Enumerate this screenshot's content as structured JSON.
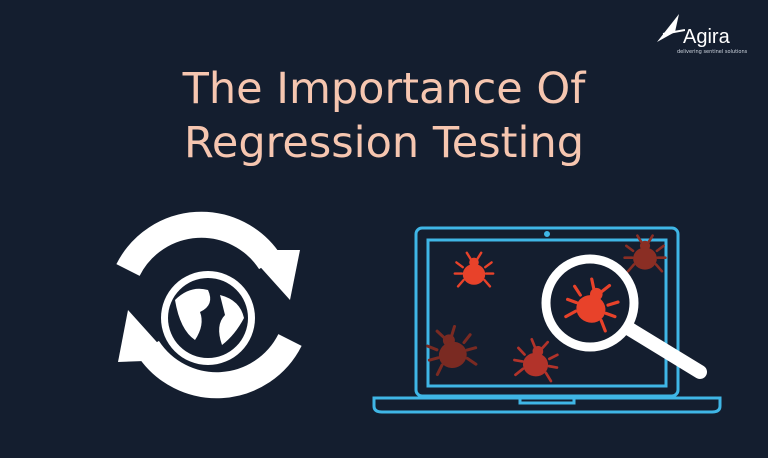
{
  "title_line1": "The Importance Of",
  "title_line2": "Regression Testing",
  "logo": {
    "name": "Agira",
    "tagline": "delivering sentinel solutions"
  },
  "icons": [
    "refresh-globe-icon",
    "laptop-icon",
    "bug-icon",
    "magnifier-icon"
  ],
  "colors": {
    "background": "#141e2f",
    "title": "#f6c6b0",
    "laptop": "#3fb6e6",
    "bug_bright": "#e8422a",
    "bug_dark": "#8a2e24"
  }
}
